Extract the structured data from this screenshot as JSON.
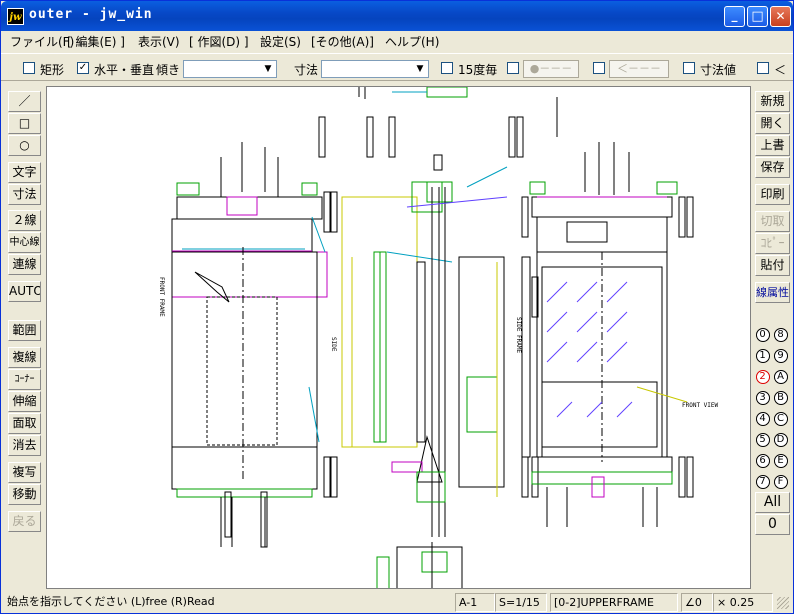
{
  "window": {
    "app_icon": "jw",
    "title": "outer - jw_win"
  },
  "title_buttons": {
    "minimize": "_",
    "maximize": "□",
    "close": "✕"
  },
  "menu": [
    "ファイル(F)",
    "[ 編集(E) ]",
    "表示(V)",
    "[ 作図(D) ]",
    "設定(S)",
    "[その他(A)]",
    "ヘルプ(H)"
  ],
  "toolbar": {
    "rect_label": "矩形",
    "rect_checked": false,
    "hv_label": "水平・垂直",
    "hv_checked": true,
    "tilt_label": "傾き",
    "tilt_value": "",
    "dim_label": "寸法",
    "dim_value": "",
    "deg15_label": "15度毎",
    "deg15_checked": false,
    "btn_circle": "●－－－",
    "btn_arrow": "＜－－－",
    "dimval_label": "寸法値",
    "dimval_checked": false,
    "last_label": "＜"
  },
  "left_tools": [
    "／",
    "□",
    "○",
    "文字",
    "寸法",
    "２線",
    "中心線",
    "連線",
    "AUTO",
    "範囲",
    "複線",
    "ｺｰﾅｰ",
    "伸縮",
    "面取",
    "消去",
    "複写",
    "移動",
    "戻る"
  ],
  "right_tools": [
    "新規",
    "開く",
    "上書",
    "保存",
    "印刷",
    "切取",
    "ｺﾋﾟｰ",
    "貼付",
    "線属性"
  ],
  "layers": [
    "0",
    "8",
    "1",
    "9",
    "2",
    "A",
    "3",
    "B",
    "4",
    "C",
    "5",
    "D",
    "6",
    "E",
    "7",
    "F"
  ],
  "active_layer": "2",
  "layer_all": "All",
  "layer_group": "0",
  "status": {
    "message": "始点を指示してください (L)free (R)Read",
    "paper": "A-1",
    "scale": "S=1/15",
    "layer": "[0-2]UPPERFRAME",
    "angle": "∠0",
    "zoom": "× 0.25"
  },
  "drawing_texts": [
    "FRONT FRAME",
    "SIDE",
    "SIDE FRAME",
    "FRONT VIEW"
  ],
  "colors": {
    "title": "#0748c7",
    "canvas": "#ffffff",
    "cad_green": "#00a000",
    "cad_magenta": "#c000c0",
    "cad_cyan": "#00a0c0",
    "cad_yellow": "#c8c800",
    "cad_purple": "#6040ff"
  }
}
